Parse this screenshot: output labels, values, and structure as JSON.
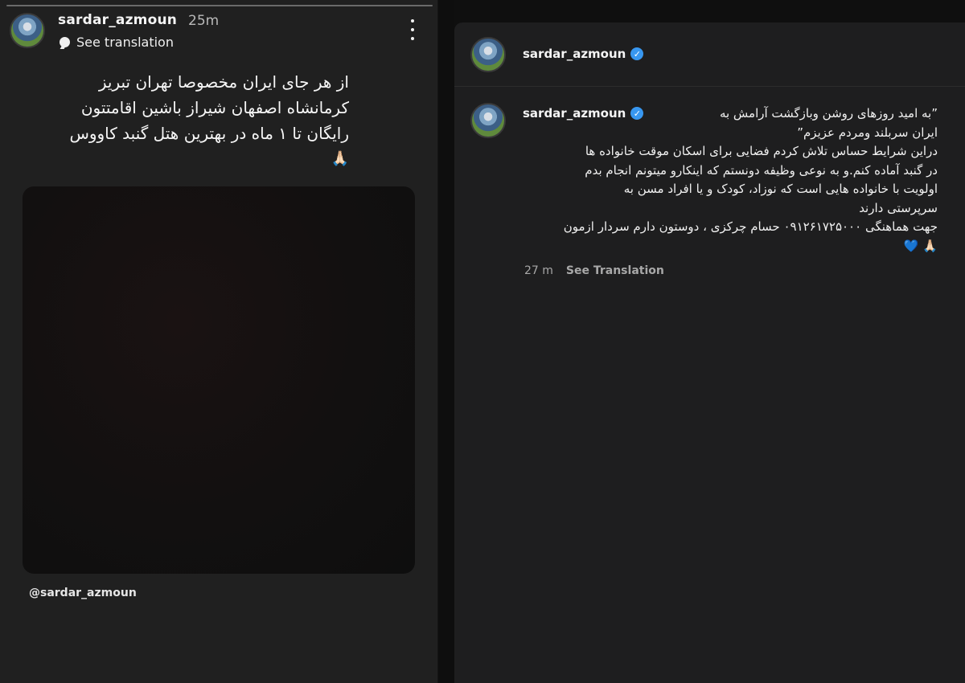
{
  "story": {
    "username": "sardar_azmoun",
    "time": "25m",
    "see_translation": "See translation",
    "text_lines": [
      "از هر جای ایران مخصوصا تهران تبریز",
      "کرمانشاه اصفهان شیراز باشین اقامتتون",
      "رایگان تا ۱ ماه در بهترین هتل گنبد کاووس",
      "🙏🏻"
    ],
    "mention": "@sardar_azmoun"
  },
  "post": {
    "username": "sardar_azmoun",
    "caption_username": "sardar_azmoun",
    "caption_lines": [
      "”به امید روزهای روشن وبازگشت آرامش به",
      "ایران سربلند ومردم عزیزم”",
      "دراین شرایط حساس تلاش کردم فضایی برای اسکان موقت خانواده ها",
      "در گنبد آماده کنم.و به نوعی وظیفه دونستم که اینکارو میتونم انجام بدم",
      "اولویت با خانواده هایی است که نوزاد، کودک و یا افراد مسن به",
      "سرپرستی دارند",
      "جهت هماهنگی ۰۹۱۲۶۱۷۲۵۰۰۰ حسام چرکزی ، دوستون دارم سردار ازمون",
      "🙏🏻 💙"
    ],
    "time": "27 m",
    "see_translation": "See Translation"
  },
  "colors": {
    "verified": "#3897f0",
    "story_bg": "#202020",
    "post_bg": "#1e1e1f"
  },
  "icons": [
    "globe-icon",
    "more-icon",
    "verified-icon",
    "avatar"
  ]
}
